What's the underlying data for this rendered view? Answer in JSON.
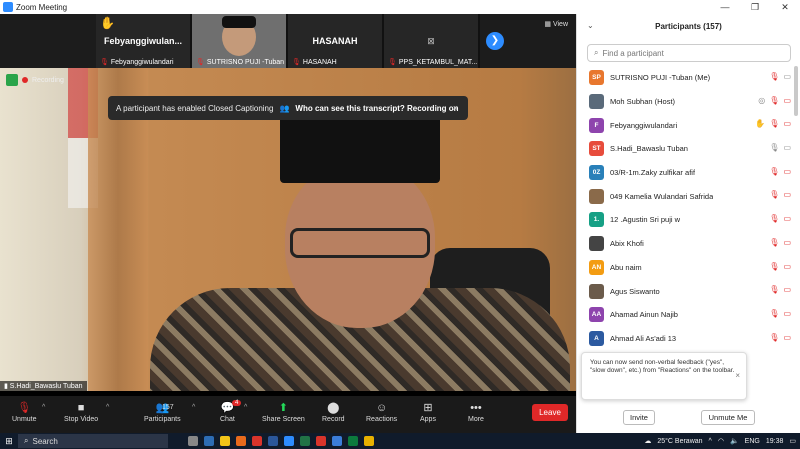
{
  "window": {
    "title": "Zoom Meeting",
    "min": "—",
    "max": "❐",
    "close": "✕"
  },
  "thumbs": [
    {
      "big": "Febyanggiwulan...",
      "tag": "Febyanggiwulandari",
      "hand": "✋"
    },
    {
      "big": "",
      "tag": "SUTRISNO PUJI -Tuban"
    },
    {
      "big": "HASANAH",
      "tag": "HASANAH"
    },
    {
      "big": "⊠",
      "tag": "PPS_KETAMBUL_MAT..."
    }
  ],
  "view_label": "View",
  "recording_label": "Recording",
  "banner": {
    "message": "A participant has enabled Closed Captioning",
    "link": "Who can see this transcript? Recording on",
    "close": "×"
  },
  "speaker_name": "S.Hadi_Bawaslu Tuban",
  "toolbar": {
    "unmute": "Unmute",
    "stop_video": "Stop Video",
    "participants": "Participants",
    "participants_count": "157",
    "chat": "Chat",
    "chat_badge": "4",
    "share_screen": "Share Screen",
    "record": "Record",
    "reactions": "Reactions",
    "apps": "Apps",
    "more": "More",
    "leave": "Leave"
  },
  "panel": {
    "title": "Participants (157)",
    "search_placeholder": "Find a participant",
    "participants": [
      {
        "initials": "SP",
        "color": "#e8772e",
        "name": "SUTRISNO PUJI -Tuban (Me)",
        "icons": [
          "mic-muted",
          "video"
        ]
      },
      {
        "initials": "",
        "color": "#5a6a7a",
        "name": "Moh Subhan (Host)",
        "icons": [
          "host",
          "mic-muted",
          "video-muted"
        ]
      },
      {
        "initials": "F",
        "color": "#8e44ad",
        "name": "Febyanggiwulandari",
        "icons": [
          "hand",
          "mic-muted",
          "video-muted"
        ]
      },
      {
        "initials": "ST",
        "color": "#e74c3c",
        "name": "S.Hadi_Bawaslu Tuban",
        "icons": [
          "mic",
          "video"
        ]
      },
      {
        "initials": "0Z",
        "color": "#2980b9",
        "name": "03/R-1m.Zaky zulfikar afif",
        "icons": [
          "mic-muted",
          "video-muted"
        ]
      },
      {
        "initials": "",
        "color": "#8a6a4a",
        "name": "049 Kamelia Wulandari Safrida",
        "icons": [
          "mic-muted",
          "video-muted"
        ]
      },
      {
        "initials": "1.",
        "color": "#16a085",
        "name": "12 .Agustin Sri puji w",
        "icons": [
          "mic-muted",
          "video-muted"
        ]
      },
      {
        "initials": "",
        "color": "#444",
        "name": "Abix Khofi",
        "icons": [
          "mic-muted",
          "video-muted"
        ]
      },
      {
        "initials": "AN",
        "color": "#f39c12",
        "name": "Abu naim",
        "icons": [
          "mic-muted",
          "video-muted"
        ]
      },
      {
        "initials": "",
        "color": "#6b5b4b",
        "name": "Agus Siswanto",
        "icons": [
          "mic-muted",
          "video-muted"
        ]
      },
      {
        "initials": "AA",
        "color": "#8e44ad",
        "name": "Ahamad Ainun Najib",
        "icons": [
          "mic-muted",
          "video-muted"
        ]
      },
      {
        "initials": "A",
        "color": "#2c5aa0",
        "name": "Ahmad Ali As'adi 13",
        "icons": [
          "mic-muted",
          "video-muted"
        ]
      }
    ],
    "tip": "You can now send non-verbal feedback (\"yes\", \"slow down\", etc.) from \"Reactions\" on the toolbar.",
    "invite": "Invite",
    "unmute_me": "Unmute Me"
  },
  "taskbar": {
    "search": "Search",
    "weather": "25°C  Berawan",
    "lang": "ENG",
    "time": "19:38"
  }
}
